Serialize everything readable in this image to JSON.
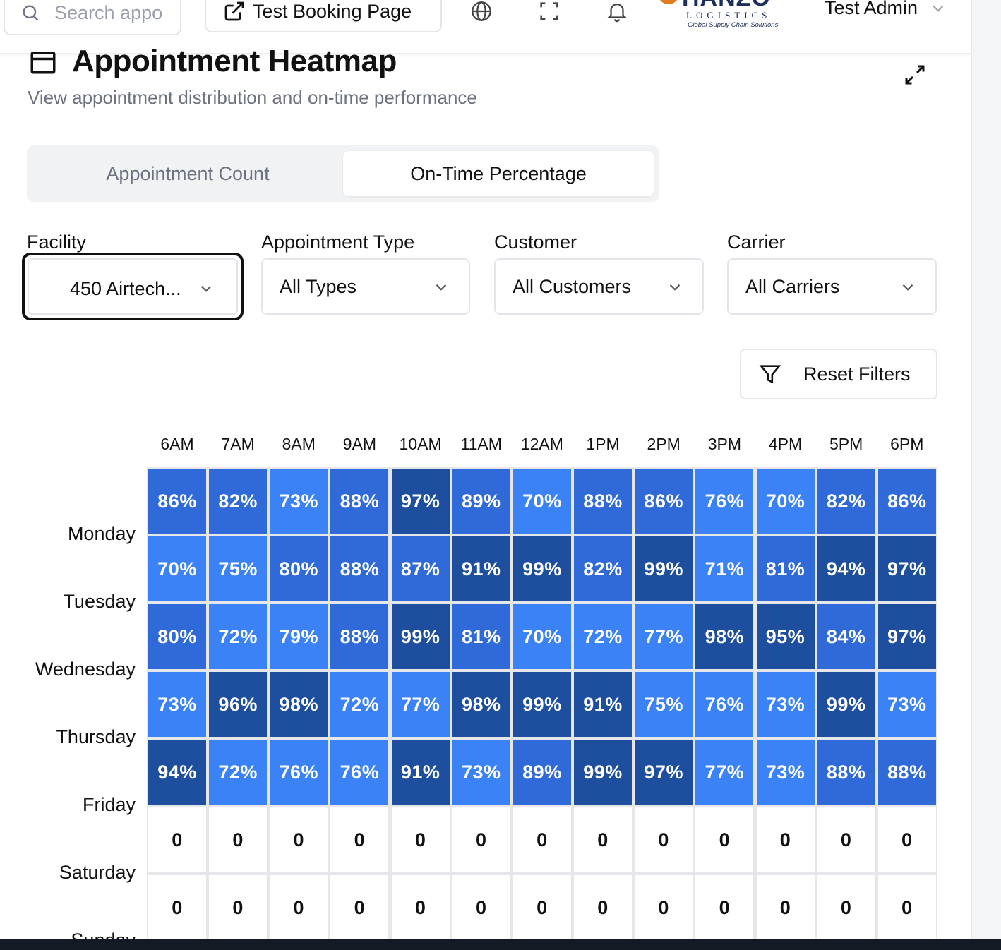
{
  "header": {
    "search_placeholder": "Search appo",
    "booking_button": "Test Booking Page",
    "logo": {
      "name": "HANZO",
      "sub": "LOGISTICS",
      "tagline": "Global Supply Chain Solutions"
    },
    "user_name": "Test Admin"
  },
  "page": {
    "title": "Appointment Heatmap",
    "subtitle": "View appointment distribution and on-time performance"
  },
  "tabs": [
    {
      "label": "Appointment Count",
      "active": false
    },
    {
      "label": "On-Time Percentage",
      "active": true
    }
  ],
  "filters": [
    {
      "label": "Facility",
      "value": "450 Airtech..."
    },
    {
      "label": "Appointment Type",
      "value": "All Types"
    },
    {
      "label": "Customer",
      "value": "All Customers"
    },
    {
      "label": "Carrier",
      "value": "All Carriers"
    }
  ],
  "reset_button": "Reset Filters",
  "colors": {
    "band_70_79": "#3b82f6",
    "band_80_89": "#2f6ad8",
    "band_90_100": "#1e4f9e",
    "zero_cell": "#ffffff"
  },
  "heatmap": {
    "hours": [
      "6AM",
      "7AM",
      "8AM",
      "9AM",
      "10AM",
      "11AM",
      "12AM",
      "1PM",
      "2PM",
      "3PM",
      "4PM",
      "5PM",
      "6PM"
    ],
    "days": [
      "Monday",
      "Tuesday",
      "Wednesday",
      "Thursday",
      "Friday",
      "Saturday",
      "Sunday"
    ],
    "rows": [
      [
        "86%",
        "82%",
        "73%",
        "88%",
        "97%",
        "89%",
        "70%",
        "88%",
        "86%",
        "76%",
        "70%",
        "82%",
        "86%"
      ],
      [
        "70%",
        "75%",
        "80%",
        "88%",
        "87%",
        "91%",
        "99%",
        "82%",
        "99%",
        "71%",
        "81%",
        "94%",
        "97%"
      ],
      [
        "80%",
        "72%",
        "79%",
        "88%",
        "99%",
        "81%",
        "70%",
        "72%",
        "77%",
        "98%",
        "95%",
        "84%",
        "97%"
      ],
      [
        "73%",
        "96%",
        "98%",
        "72%",
        "77%",
        "98%",
        "99%",
        "91%",
        "75%",
        "76%",
        "73%",
        "99%",
        "73%"
      ],
      [
        "94%",
        "72%",
        "76%",
        "76%",
        "91%",
        "73%",
        "89%",
        "99%",
        "97%",
        "77%",
        "73%",
        "88%",
        "88%"
      ],
      [
        "0",
        "0",
        "0",
        "0",
        "0",
        "0",
        "0",
        "0",
        "0",
        "0",
        "0",
        "0",
        "0"
      ],
      [
        "0",
        "0",
        "0",
        "0",
        "0",
        "0",
        "0",
        "0",
        "0",
        "0",
        "0",
        "0",
        "0"
      ]
    ]
  }
}
